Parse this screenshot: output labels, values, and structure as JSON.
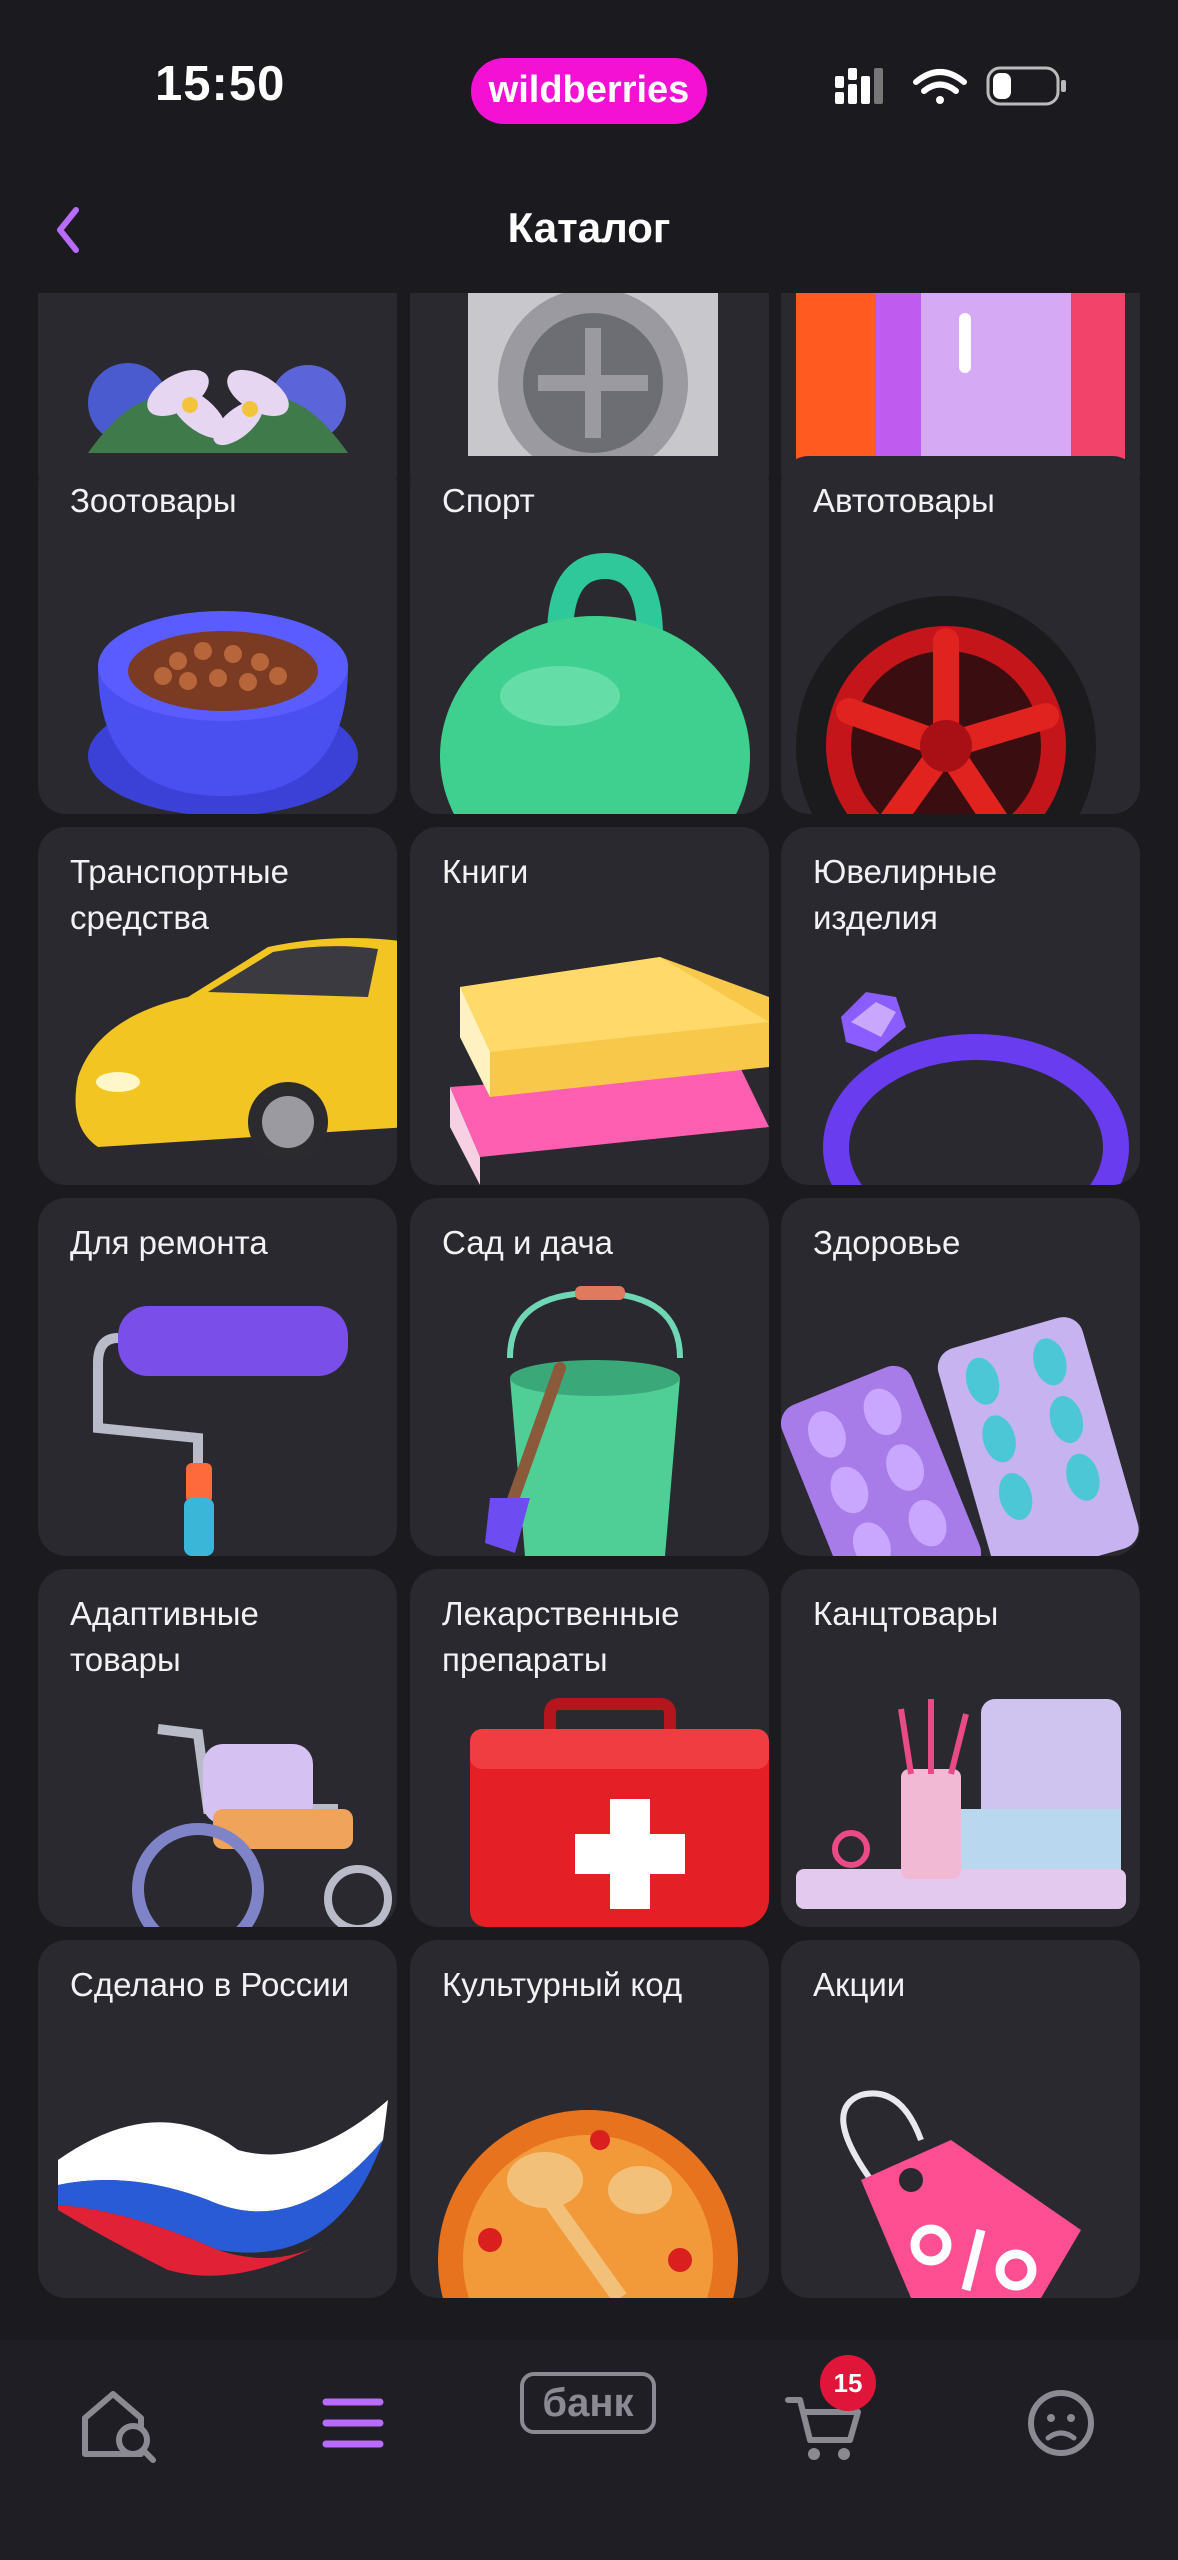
{
  "status_bar": {
    "time": "15:50",
    "brand": "wildberries",
    "icons": [
      "signal-icon",
      "wifi-icon",
      "battery-icon"
    ]
  },
  "header": {
    "title": "Каталог",
    "back_icon": "chevron-left-icon"
  },
  "categories": [
    {
      "label": "",
      "icon": "flowers"
    },
    {
      "label": "",
      "icon": "washing-machine"
    },
    {
      "label": "",
      "icon": "fridge"
    },
    {
      "label": "Зоотовары",
      "icon": "pet-bowl"
    },
    {
      "label": "Спорт",
      "icon": "kettlebell"
    },
    {
      "label": "Автотовары",
      "icon": "wheel"
    },
    {
      "label": "Транспортные средства",
      "icon": "car"
    },
    {
      "label": "Книги",
      "icon": "books"
    },
    {
      "label": "Ювелирные изделия",
      "icon": "ring"
    },
    {
      "label": "Для ремонта",
      "icon": "paint-roller"
    },
    {
      "label": "Сад и дача",
      "icon": "bucket"
    },
    {
      "label": "Здоровье",
      "icon": "pills"
    },
    {
      "label": "Адаптивные товары",
      "icon": "wheelchair"
    },
    {
      "label": "Лекарственные препараты",
      "icon": "first-aid-kit"
    },
    {
      "label": "Канцтовары",
      "icon": "stationery"
    },
    {
      "label": "Сделано в России",
      "icon": "russia-flag-wave"
    },
    {
      "label": "Культурный код",
      "icon": "painted-plate"
    },
    {
      "label": "Акции",
      "icon": "sale-tag"
    }
  ],
  "bottom_nav": {
    "items": [
      {
        "name": "home-search",
        "icon": "home-search-icon"
      },
      {
        "name": "catalog",
        "icon": "menu-icon",
        "active": true
      },
      {
        "name": "bank",
        "label": "банк"
      },
      {
        "name": "cart",
        "icon": "cart-icon",
        "badge": "15"
      },
      {
        "name": "profile",
        "icon": "profile-icon"
      }
    ]
  },
  "colors": {
    "background": "#1b1a1f",
    "card": "#2a2930",
    "accent": "#b96bff",
    "brand": "#f511d4",
    "badge": "#e0153a"
  }
}
